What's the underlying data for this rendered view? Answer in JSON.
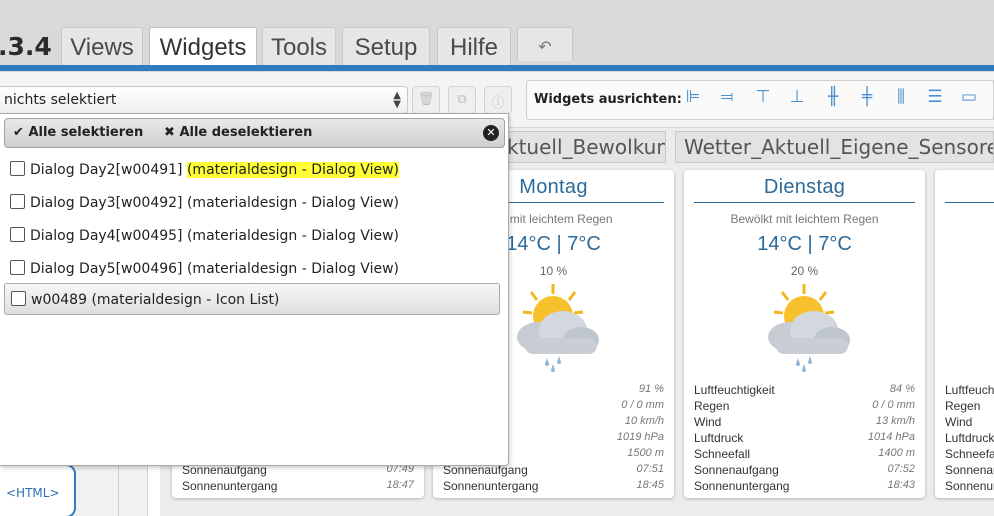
{
  "app": {
    "version_fragment": ".3.4"
  },
  "tabs": [
    {
      "label": "Views"
    },
    {
      "label": "Widgets"
    },
    {
      "label": "Tools"
    },
    {
      "label": "Setup"
    },
    {
      "label": "Hilfe"
    },
    {
      "label": "↶",
      "icon": "undo-icon"
    }
  ],
  "toolbar": {
    "widget_select_value": "nichts selektiert",
    "align_label": "Widgets ausrichten:"
  },
  "dropdown": {
    "select_all": "Alle selektieren",
    "deselect_all": "Alle deselektieren",
    "items": [
      {
        "name": "Dialog Day2[w00491]",
        "suffix": "(materialdesign - Dialog View)",
        "highlighted": true,
        "checked": false
      },
      {
        "name": "Dialog Day3[w00492]",
        "suffix": "(materialdesign - Dialog View)",
        "highlighted": false,
        "checked": false
      },
      {
        "name": "Dialog Day4[w00495]",
        "suffix": "(materialdesign - Dialog View)",
        "highlighted": false,
        "checked": false
      },
      {
        "name": "Dialog Day5[w00496]",
        "suffix": "(materialdesign - Dialog View)",
        "highlighted": false,
        "checked": false
      },
      {
        "name": "w00489",
        "suffix": "(materialdesign - Icon List)",
        "highlighted": false,
        "checked": false
      }
    ]
  },
  "canvas": {
    "view_tabs": [
      "ktuell_Bewolkung",
      "Wetter_Aktuell_Eigene_Sensoren"
    ],
    "html_widget_label": "<HTML>",
    "cards": [
      {
        "day": "",
        "desc": "",
        "temps": "",
        "precip": "",
        "rows": [
          {
            "k": "Sonnenaufgang",
            "v": "07:49"
          },
          {
            "k": "Sonnenuntergang",
            "v": "18:47"
          }
        ]
      },
      {
        "day": "Montag",
        "desc": "lkt mit leichtem Regen",
        "temps": "14°C  |  7°C",
        "precip": "10 %",
        "rows": [
          {
            "k": "keit",
            "v": "91 %"
          },
          {
            "k": "",
            "v": "0 / 0 mm"
          },
          {
            "k": "",
            "v": "10 km/h"
          },
          {
            "k": "",
            "v": "1019 hPa"
          },
          {
            "k": "",
            "v": "1500 m"
          },
          {
            "k": "Sonnenaufgang",
            "v": "07:51"
          },
          {
            "k": "Sonnenuntergang",
            "v": "18:45"
          }
        ]
      },
      {
        "day": "Dienstag",
        "desc": "Bewölkt mit leichtem Regen",
        "temps": "14°C  |  7°C",
        "precip": "20 %",
        "rows": [
          {
            "k": "Luftfeuchtigkeit",
            "v": "84 %"
          },
          {
            "k": "Regen",
            "v": "0 / 0 mm"
          },
          {
            "k": "Wind",
            "v": "13 km/h"
          },
          {
            "k": "Luftdruck",
            "v": "1014 hPa"
          },
          {
            "k": "Schneefall",
            "v": "1400 m"
          },
          {
            "k": "Sonnenaufgang",
            "v": "07:52"
          },
          {
            "k": "Sonnenuntergang",
            "v": "18:43"
          }
        ]
      },
      {
        "day": "",
        "desc": "",
        "temps": "",
        "precip": "",
        "rows": [
          {
            "k": "Luftfeuch",
            "v": ""
          },
          {
            "k": "Regen",
            "v": ""
          },
          {
            "k": "Wind",
            "v": ""
          },
          {
            "k": "Luftdruck",
            "v": ""
          },
          {
            "k": "Schneefa",
            "v": ""
          },
          {
            "k": "Sonnenau",
            "v": ""
          },
          {
            "k": "Sonnenun",
            "v": ""
          }
        ]
      }
    ]
  },
  "colors": {
    "accent": "#2f7cc1",
    "day_title": "#2c6a9a",
    "highlight": "#ffff33"
  }
}
